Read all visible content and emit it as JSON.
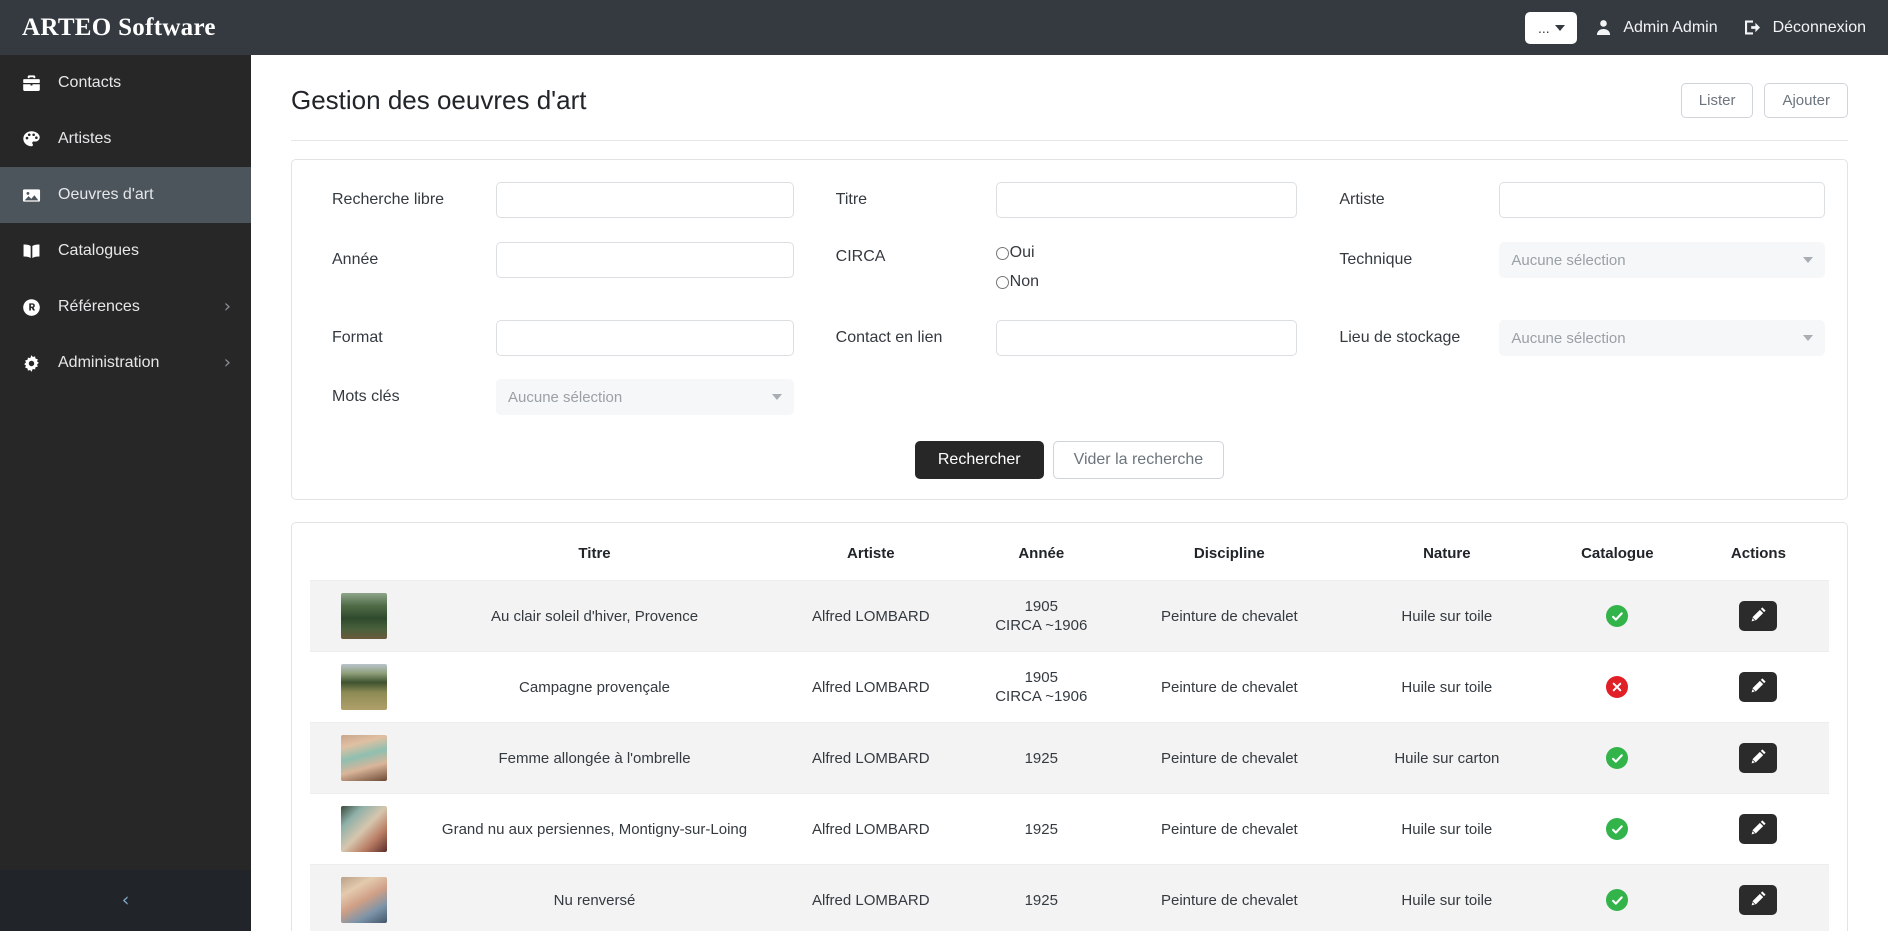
{
  "app": {
    "brand": "ARTEO Software"
  },
  "topbar": {
    "dots_label": "...",
    "user_icon": "user-icon",
    "user_name": "Admin Admin",
    "logout_icon": "logout-icon",
    "logout_label": "Déconnexion"
  },
  "sidebar": {
    "items": [
      {
        "label": "Contacts",
        "icon": "briefcase-icon",
        "active": false,
        "chevron": false
      },
      {
        "label": "Artistes",
        "icon": "palette-icon",
        "active": false,
        "chevron": false
      },
      {
        "label": "Oeuvres d'art",
        "icon": "picture-icon",
        "active": true,
        "chevron": false
      },
      {
        "label": "Catalogues",
        "icon": "book-icon",
        "active": false,
        "chevron": false
      },
      {
        "label": "Références",
        "icon": "registered-icon",
        "active": false,
        "chevron": true
      },
      {
        "label": "Administration",
        "icon": "gear-icon",
        "active": false,
        "chevron": true
      }
    ],
    "collapse_icon": "chevron-left-icon"
  },
  "page": {
    "title": "Gestion des oeuvres d'art",
    "btn_list": "Lister",
    "btn_add": "Ajouter"
  },
  "search": {
    "labels": {
      "recherche_libre": "Recherche libre",
      "titre": "Titre",
      "artiste": "Artiste",
      "annee": "Année",
      "circa": "CIRCA",
      "technique": "Technique",
      "format": "Format",
      "contact_en_lien": "Contact en lien",
      "lieu_de_stockage": "Lieu de stockage",
      "mots_cles": "Mots clés"
    },
    "values": {
      "recherche_libre": "",
      "titre": "",
      "artiste": "",
      "annee": "",
      "format": "",
      "contact_en_lien": ""
    },
    "selects": {
      "technique": "Aucune sélection",
      "lieu_de_stockage": "Aucune sélection",
      "mots_cles": "Aucune sélection"
    },
    "circa": {
      "oui": "Oui",
      "non": "Non",
      "selected": null
    },
    "btn_search": "Rechercher",
    "btn_clear": "Vider la recherche"
  },
  "table": {
    "columns": [
      "",
      "Titre",
      "Artiste",
      "Année",
      "Discipline",
      "Nature",
      "Catalogue",
      "Actions"
    ],
    "rows": [
      {
        "thumb": "thumbnail-landscape-green",
        "titre": "Au clair soleil d'hiver, Provence",
        "artiste": "Alfred LOMBARD",
        "annee": "1905",
        "annee_sub": "CIRCA ~1906",
        "discipline": "Peinture de chevalet",
        "nature": "Huile sur toile",
        "catalogue": "check",
        "action_icon": "pencil-icon"
      },
      {
        "thumb": "thumbnail-landscape-field",
        "titre": "Campagne provençale",
        "artiste": "Alfred LOMBARD",
        "annee": "1905",
        "annee_sub": "CIRCA ~1906",
        "discipline": "Peinture de chevalet",
        "nature": "Huile sur toile",
        "catalogue": "cross",
        "action_icon": "pencil-icon"
      },
      {
        "thumb": "thumbnail-nude-parasol",
        "titre": "Femme allongée à l'ombrelle",
        "artiste": "Alfred LOMBARD",
        "annee": "1925",
        "annee_sub": "",
        "discipline": "Peinture de chevalet",
        "nature": "Huile sur carton",
        "catalogue": "check",
        "action_icon": "pencil-icon"
      },
      {
        "thumb": "thumbnail-nude-shutters",
        "titre": "Grand nu aux persiennes, Montigny-sur-Loing",
        "artiste": "Alfred LOMBARD",
        "annee": "1925",
        "annee_sub": "",
        "discipline": "Peinture de chevalet",
        "nature": "Huile sur toile",
        "catalogue": "check",
        "action_icon": "pencil-icon"
      },
      {
        "thumb": "thumbnail-nude-reclining",
        "titre": "Nu renversé",
        "artiste": "Alfred LOMBARD",
        "annee": "1925",
        "annee_sub": "",
        "discipline": "Peinture de chevalet",
        "nature": "Huile sur toile",
        "catalogue": "check",
        "action_icon": "pencil-icon"
      }
    ]
  },
  "colors": {
    "topbar": "#343a40",
    "sidebar": "#272727",
    "sidebar_active": "#4c545c",
    "primary_button": "#272727",
    "status_ok": "#32b44a",
    "status_no": "#e01f26"
  }
}
